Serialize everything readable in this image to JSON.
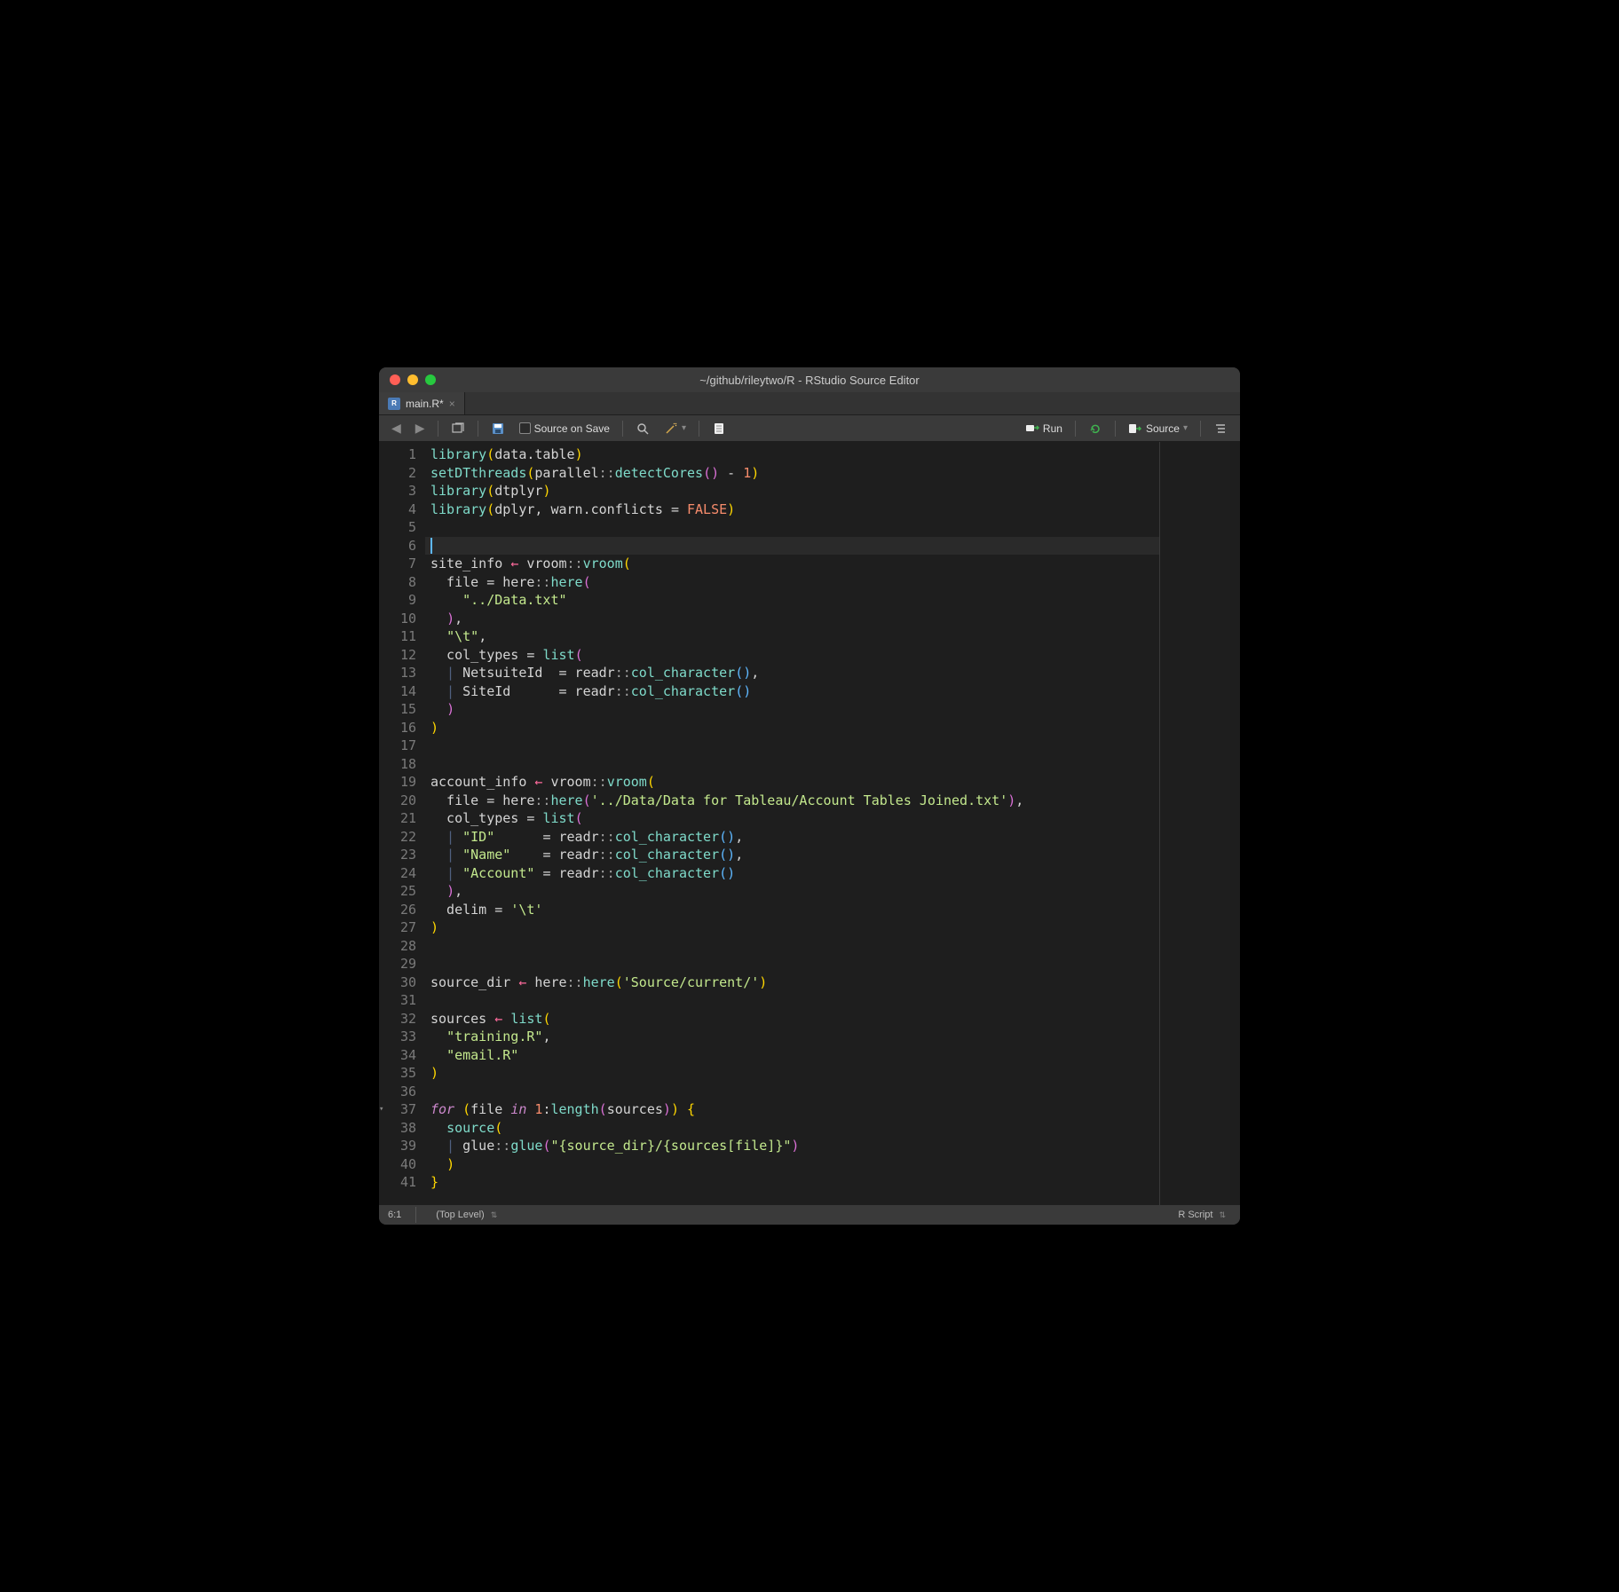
{
  "window": {
    "title": "~/github/rileytwo/R - RStudio Source Editor"
  },
  "tab": {
    "filename": "main.R*"
  },
  "toolbar": {
    "source_on_save": "Source on Save",
    "run": "Run",
    "source": "Source"
  },
  "statusbar": {
    "position": "6:1",
    "scope": "(Top Level)",
    "filetype": "R Script"
  },
  "code": {
    "line_count": 41,
    "active_line": 6,
    "fold_line": 37,
    "lines": [
      [
        [
          "fn",
          "library"
        ],
        [
          "paren",
          "("
        ],
        [
          "id",
          "data.table"
        ],
        [
          "paren",
          ")"
        ]
      ],
      [
        [
          "fn",
          "setDTthreads"
        ],
        [
          "paren",
          "("
        ],
        [
          "id",
          "parallel"
        ],
        [
          "ns",
          "::"
        ],
        [
          "fn",
          "detectCores"
        ],
        [
          "paren2",
          "("
        ],
        [
          "paren2",
          ")"
        ],
        [
          "id",
          " "
        ],
        [
          "op",
          "-"
        ],
        [
          "id",
          " "
        ],
        [
          "num",
          "1"
        ],
        [
          "paren",
          ")"
        ]
      ],
      [
        [
          "fn",
          "library"
        ],
        [
          "paren",
          "("
        ],
        [
          "id",
          "dtplyr"
        ],
        [
          "paren",
          ")"
        ]
      ],
      [
        [
          "fn",
          "library"
        ],
        [
          "paren",
          "("
        ],
        [
          "id",
          "dplyr"
        ],
        [
          "op",
          ","
        ],
        [
          "id",
          " warn.conflicts "
        ],
        [
          "op",
          "="
        ],
        [
          "id",
          " "
        ],
        [
          "const",
          "FALSE"
        ],
        [
          "paren",
          ")"
        ]
      ],
      [],
      [],
      [
        [
          "id",
          "site_info "
        ],
        [
          "assign",
          "←"
        ],
        [
          "id",
          " vroom"
        ],
        [
          "ns",
          "::"
        ],
        [
          "fn",
          "vroom"
        ],
        [
          "paren",
          "("
        ]
      ],
      [
        [
          "id",
          "  file "
        ],
        [
          "op",
          "="
        ],
        [
          "id",
          " here"
        ],
        [
          "ns",
          "::"
        ],
        [
          "fn",
          "here"
        ],
        [
          "paren2",
          "("
        ]
      ],
      [
        [
          "id",
          "    "
        ],
        [
          "str",
          "\"../Data.txt\""
        ]
      ],
      [
        [
          "id",
          "  "
        ],
        [
          "paren2",
          ")"
        ],
        [
          "op",
          ","
        ]
      ],
      [
        [
          "id",
          "  "
        ],
        [
          "str",
          "\"\\t\""
        ],
        [
          "op",
          ","
        ]
      ],
      [
        [
          "id",
          "  col_types "
        ],
        [
          "op",
          "="
        ],
        [
          "id",
          " "
        ],
        [
          "fn",
          "list"
        ],
        [
          "paren2",
          "("
        ]
      ],
      [
        [
          "pipe",
          "  | "
        ],
        [
          "id",
          "NetsuiteId  "
        ],
        [
          "op",
          "="
        ],
        [
          "id",
          " readr"
        ],
        [
          "ns",
          "::"
        ],
        [
          "fn",
          "col_character"
        ],
        [
          "paren3",
          "("
        ],
        [
          "paren3",
          ")"
        ],
        [
          "op",
          ","
        ]
      ],
      [
        [
          "pipe",
          "  | "
        ],
        [
          "id",
          "SiteId      "
        ],
        [
          "op",
          "="
        ],
        [
          "id",
          " readr"
        ],
        [
          "ns",
          "::"
        ],
        [
          "fn",
          "col_character"
        ],
        [
          "paren3",
          "("
        ],
        [
          "paren3",
          ")"
        ]
      ],
      [
        [
          "id",
          "  "
        ],
        [
          "paren2",
          ")"
        ]
      ],
      [
        [
          "paren",
          ")"
        ]
      ],
      [],
      [],
      [
        [
          "id",
          "account_info "
        ],
        [
          "assign",
          "←"
        ],
        [
          "id",
          " vroom"
        ],
        [
          "ns",
          "::"
        ],
        [
          "fn",
          "vroom"
        ],
        [
          "paren",
          "("
        ]
      ],
      [
        [
          "id",
          "  file "
        ],
        [
          "op",
          "="
        ],
        [
          "id",
          " here"
        ],
        [
          "ns",
          "::"
        ],
        [
          "fn",
          "here"
        ],
        [
          "paren2",
          "("
        ],
        [
          "str",
          "'../Data/Data for Tableau/Account Tables Joined.txt'"
        ],
        [
          "paren2",
          ")"
        ],
        [
          "op",
          ","
        ]
      ],
      [
        [
          "id",
          "  col_types "
        ],
        [
          "op",
          "="
        ],
        [
          "id",
          " "
        ],
        [
          "fn",
          "list"
        ],
        [
          "paren2",
          "("
        ]
      ],
      [
        [
          "pipe",
          "  | "
        ],
        [
          "str",
          "\"ID\""
        ],
        [
          "id",
          "      "
        ],
        [
          "op",
          "="
        ],
        [
          "id",
          " readr"
        ],
        [
          "ns",
          "::"
        ],
        [
          "fn",
          "col_character"
        ],
        [
          "paren3",
          "("
        ],
        [
          "paren3",
          ")"
        ],
        [
          "op",
          ","
        ]
      ],
      [
        [
          "pipe",
          "  | "
        ],
        [
          "str",
          "\"Name\""
        ],
        [
          "id",
          "    "
        ],
        [
          "op",
          "="
        ],
        [
          "id",
          " readr"
        ],
        [
          "ns",
          "::"
        ],
        [
          "fn",
          "col_character"
        ],
        [
          "paren3",
          "("
        ],
        [
          "paren3",
          ")"
        ],
        [
          "op",
          ","
        ]
      ],
      [
        [
          "pipe",
          "  | "
        ],
        [
          "str",
          "\"Account\""
        ],
        [
          "id",
          " "
        ],
        [
          "op",
          "="
        ],
        [
          "id",
          " readr"
        ],
        [
          "ns",
          "::"
        ],
        [
          "fn",
          "col_character"
        ],
        [
          "paren3",
          "("
        ],
        [
          "paren3",
          ")"
        ]
      ],
      [
        [
          "id",
          "  "
        ],
        [
          "paren2",
          ")"
        ],
        [
          "op",
          ","
        ]
      ],
      [
        [
          "id",
          "  delim "
        ],
        [
          "op",
          "="
        ],
        [
          "id",
          " "
        ],
        [
          "str",
          "'\\t'"
        ]
      ],
      [
        [
          "paren",
          ")"
        ]
      ],
      [],
      [],
      [
        [
          "id",
          "source_dir "
        ],
        [
          "assign",
          "←"
        ],
        [
          "id",
          " here"
        ],
        [
          "ns",
          "::"
        ],
        [
          "fn",
          "here"
        ],
        [
          "paren",
          "("
        ],
        [
          "str",
          "'Source/current/'"
        ],
        [
          "paren",
          ")"
        ]
      ],
      [],
      [
        [
          "id",
          "sources "
        ],
        [
          "assign",
          "←"
        ],
        [
          "id",
          " "
        ],
        [
          "fn",
          "list"
        ],
        [
          "paren",
          "("
        ]
      ],
      [
        [
          "id",
          "  "
        ],
        [
          "str",
          "\"training.R\""
        ],
        [
          "op",
          ","
        ]
      ],
      [
        [
          "id",
          "  "
        ],
        [
          "str",
          "\"email.R\""
        ]
      ],
      [
        [
          "paren",
          ")"
        ]
      ],
      [],
      [
        [
          "kw",
          "for"
        ],
        [
          "id",
          " "
        ],
        [
          "paren",
          "("
        ],
        [
          "id",
          "file "
        ],
        [
          "kw",
          "in"
        ],
        [
          "id",
          " "
        ],
        [
          "num",
          "1"
        ],
        [
          "op",
          ":"
        ],
        [
          "fn",
          "length"
        ],
        [
          "paren2",
          "("
        ],
        [
          "id",
          "sources"
        ],
        [
          "paren2",
          ")"
        ],
        [
          "paren",
          ")"
        ],
        [
          "id",
          " "
        ],
        [
          "brace",
          "{"
        ]
      ],
      [
        [
          "id",
          "  "
        ],
        [
          "fn",
          "source"
        ],
        [
          "paren",
          "("
        ]
      ],
      [
        [
          "pipe",
          "  | "
        ],
        [
          "id",
          "glue"
        ],
        [
          "ns",
          "::"
        ],
        [
          "fn",
          "glue"
        ],
        [
          "paren2",
          "("
        ],
        [
          "str",
          "\"{source_dir}/{sources[file]}\""
        ],
        [
          "paren2",
          ")"
        ]
      ],
      [
        [
          "id",
          "  "
        ],
        [
          "paren",
          ")"
        ]
      ],
      [
        [
          "brace",
          "}"
        ]
      ]
    ]
  }
}
